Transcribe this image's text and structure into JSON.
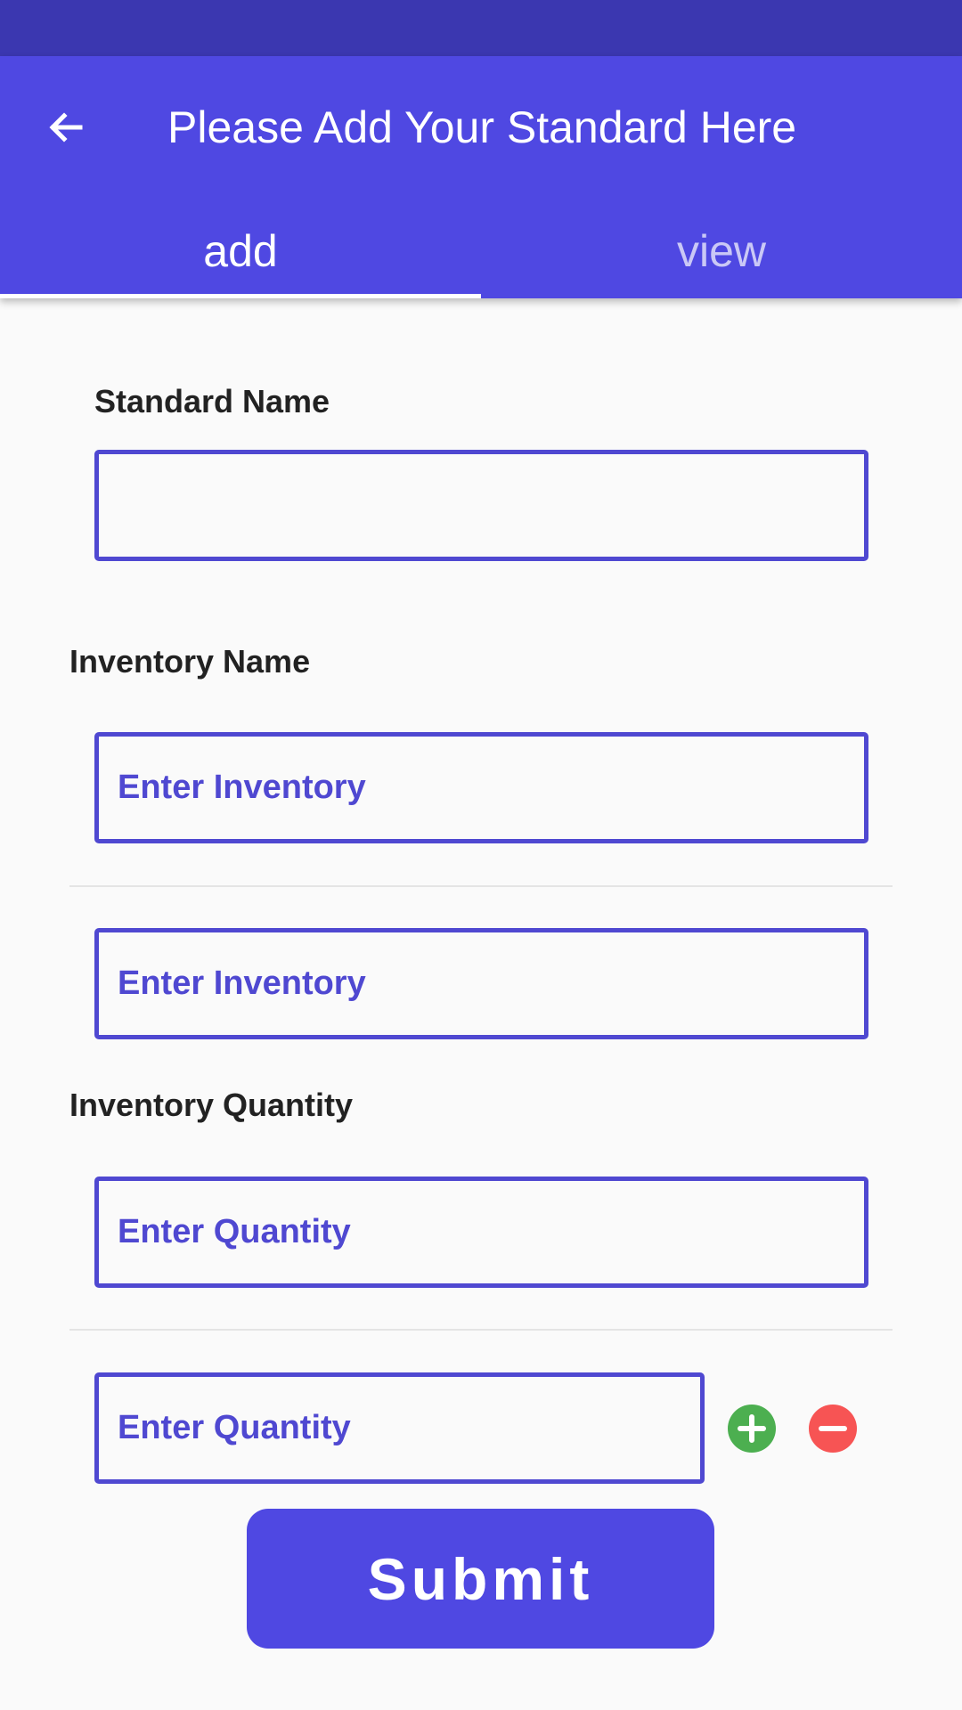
{
  "header": {
    "title": "Please Add Your Standard Here",
    "back_icon": "arrow-left-icon"
  },
  "tabs": [
    {
      "label": "add",
      "active": true
    },
    {
      "label": "view",
      "active": false
    }
  ],
  "form": {
    "standard_name_label": "Standard Name",
    "standard_name_value": "",
    "inventory_label": "Inventory Name",
    "inventory_fields": [
      {
        "placeholder": "Enter Inventory",
        "value": ""
      },
      {
        "placeholder": "Enter Inventory",
        "value": ""
      }
    ],
    "quantity_label": "Inventory Quantity",
    "quantity_fields": [
      {
        "placeholder": "Enter Quantity",
        "value": ""
      },
      {
        "placeholder": "Enter Quantity",
        "value": ""
      }
    ],
    "add_icon": "plus-circle-icon",
    "remove_icon": "minus-circle-icon",
    "submit_label": "Submit"
  },
  "colors": {
    "status_bar": "#3b37b0",
    "primary": "#4f48e2",
    "field_border": "#4f48d1",
    "add": "#4caf50",
    "remove": "#f75454",
    "background": "#fafafa"
  }
}
